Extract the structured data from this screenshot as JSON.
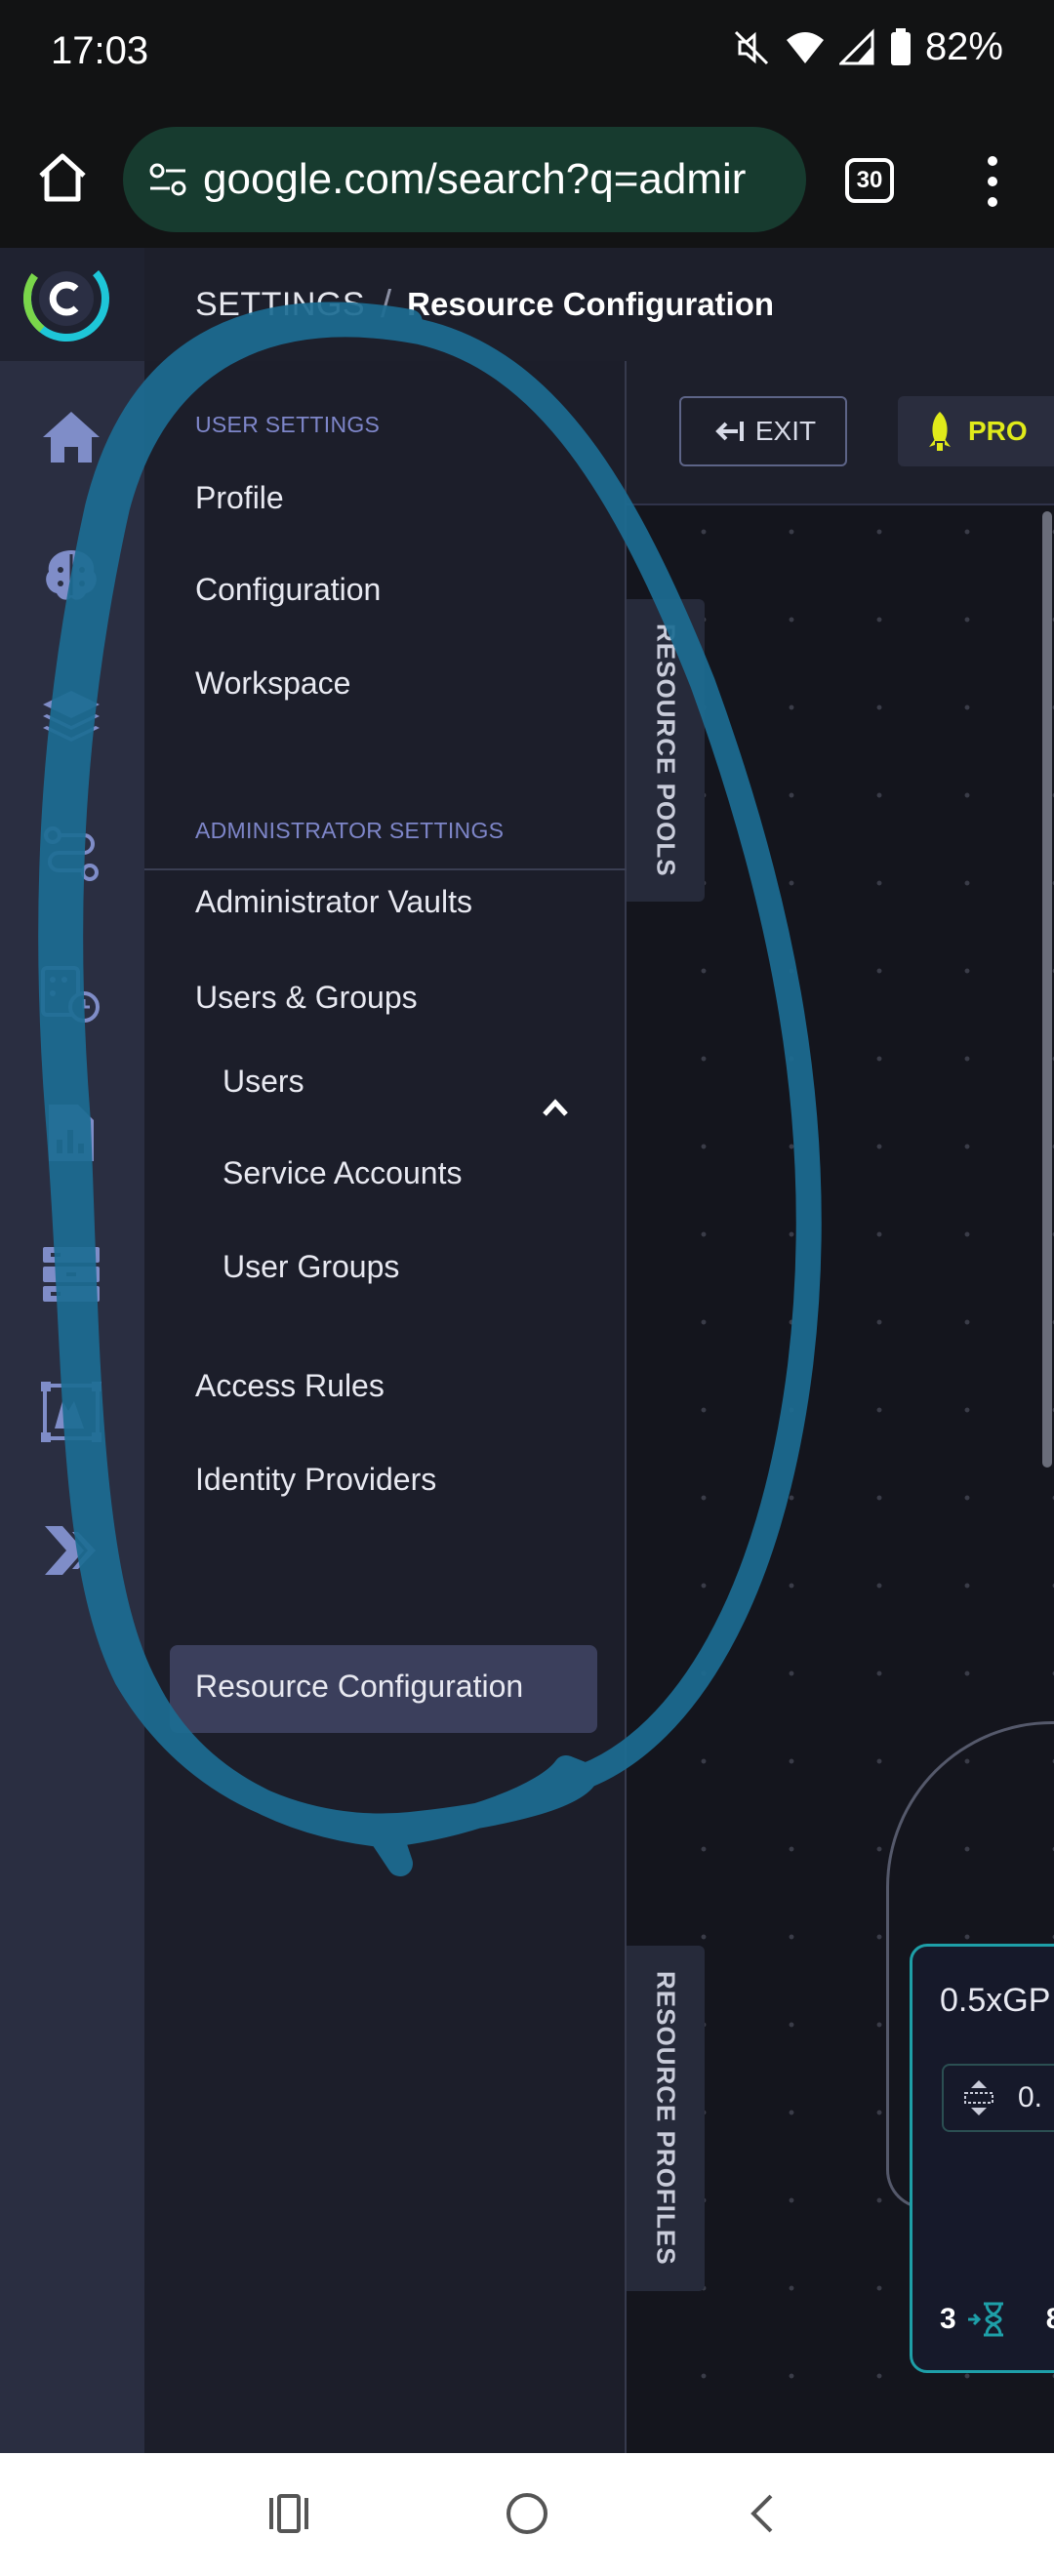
{
  "status_bar": {
    "time": "17:03",
    "battery": "82%"
  },
  "browser": {
    "url": "google.com/search?q=admir",
    "tab_count": "30"
  },
  "breadcrumb": {
    "section": "SETTINGS",
    "separator": "/",
    "current": "Resource Configuration"
  },
  "sidebar": {
    "user_settings_title": "USER SETTINGS",
    "user_items": [
      "Profile",
      "Configuration",
      "Workspace"
    ],
    "admin_settings_title": "ADMINISTRATOR SETTINGS",
    "admin_vaults": "Administrator Vaults",
    "users_groups": "Users & Groups",
    "users_groups_children": [
      "Users",
      "Service Accounts",
      "User Groups"
    ],
    "access_rules": "Access Rules",
    "identity_providers": "Identity Providers",
    "resource_configuration": "Resource Configuration"
  },
  "toolbar": {
    "exit_label": "EXIT",
    "provision_label": "PRO"
  },
  "canvas": {
    "resource_pools_tab": "RESOURCE POOLS",
    "resource_profiles_tab": "RESOURCE PROFILES",
    "card_title": "0.5xGP",
    "card_value": "0.",
    "card_count_a": "3",
    "card_count_b": "8"
  },
  "colors": {
    "accent_teal": "#1e9fa8",
    "provision_yellow": "#e0ea1a",
    "annotation_circle": "#1c6d93"
  }
}
